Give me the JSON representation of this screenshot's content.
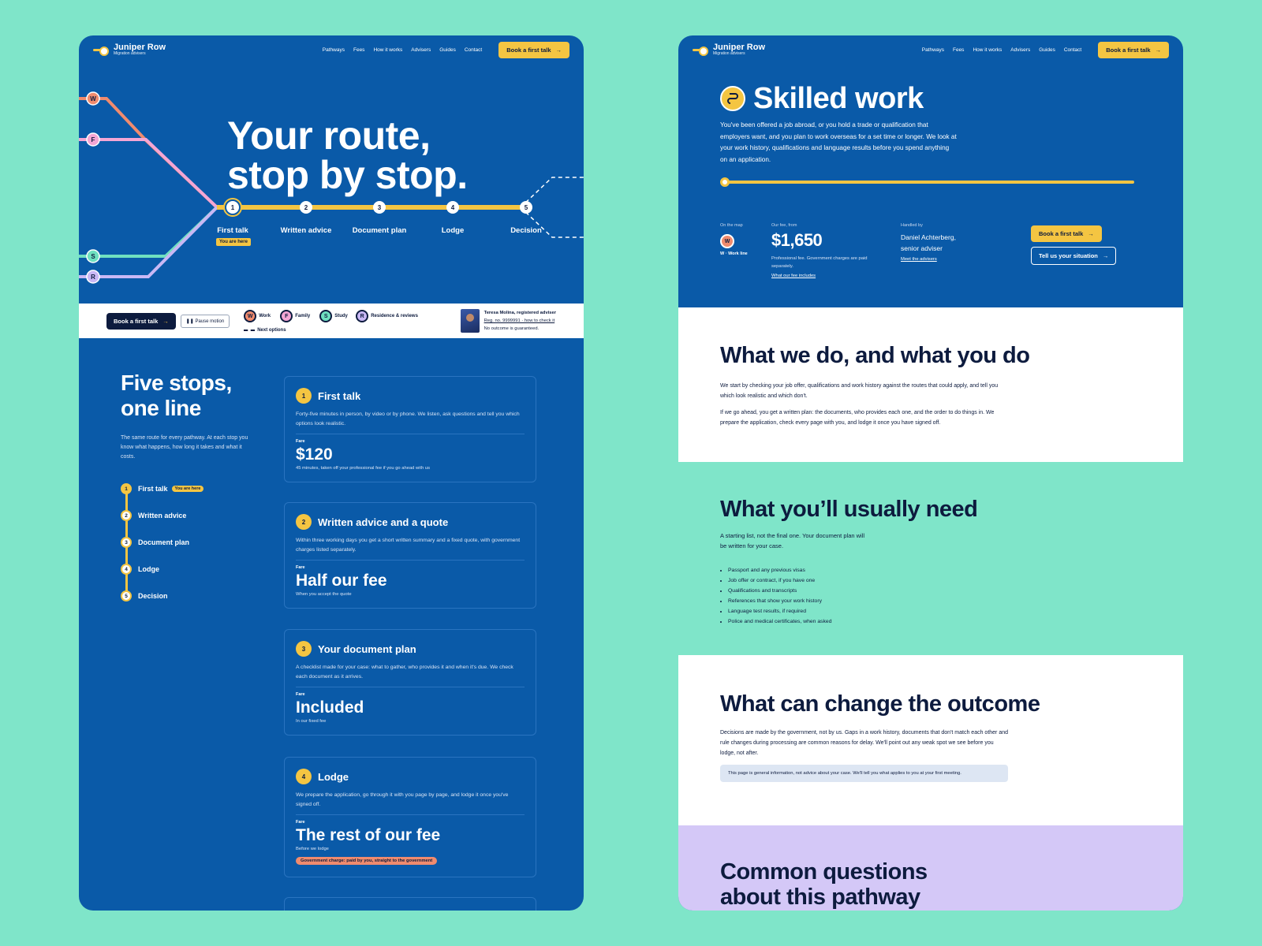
{
  "brand": {
    "name": "Juniper Row",
    "sub": "Migration advisers"
  },
  "nav": {
    "links": [
      "Pathways",
      "Fees",
      "How it works",
      "Advisers",
      "Guides",
      "Contact"
    ],
    "cta": "Book a first talk",
    "arrow": "→"
  },
  "home": {
    "hero_title_1": "Your route,",
    "hero_title_2": "stop by stop.",
    "line_badges": [
      "W",
      "F",
      "S",
      "R"
    ],
    "stations": [
      "First talk",
      "Written advice",
      "Document plan",
      "Lodge",
      "Decision"
    ],
    "station_numbers": [
      "1",
      "2",
      "3",
      "4",
      "5"
    ],
    "you_are_here": "You are here",
    "cta": "Book a first talk",
    "pause": "Pause motion",
    "pause_icon": "❚❚",
    "legend": [
      {
        "badge": "W",
        "label": "Work",
        "color": "#f08b6e"
      },
      {
        "badge": "F",
        "label": "Family",
        "color": "#f4a6d4"
      },
      {
        "badge": "S",
        "label": "Study",
        "color": "#6fe0c0"
      },
      {
        "badge": "R",
        "label": "Residence & reviews",
        "color": "#c9b8f5"
      }
    ],
    "next_options": "Next options",
    "adviser": {
      "name": "Teresa Molina, registered adviser",
      "reg": "Reg. no. 9999991 · how to check it",
      "disclaimer": "No outcome is guaranteed."
    },
    "stops_title_1": "Five stops,",
    "stops_title_2": "one line",
    "stops_desc": "The same route for every pathway. At each stop you know what happens, how long it takes and what it costs.",
    "mini_route": [
      "First talk",
      "Written advice",
      "Document plan",
      "Lodge",
      "Decision"
    ],
    "fare_label": "Fare",
    "cards": [
      {
        "num": "1",
        "title": "First talk",
        "desc": "Forty-five minutes in person, by video or by phone. We listen, ask questions and tell you which options look realistic.",
        "fare": "$120",
        "note": "45 minutes, taken off your professional fee if you go ahead with us"
      },
      {
        "num": "2",
        "title": "Written advice and a quote",
        "desc": "Within three working days you get a short written summary and a fixed quote, with government charges listed separately.",
        "fare": "Half our fee",
        "note": "When you accept the quote"
      },
      {
        "num": "3",
        "title": "Your document plan",
        "desc": "A checklist made for your case: what to gather, who provides it and when it's due. We check each document as it arrives.",
        "fare": "Included",
        "note": "In our fixed fee"
      },
      {
        "num": "4",
        "title": "Lodge",
        "desc": "We prepare the application, go through it with you page by page, and lodge it once you've signed off.",
        "fare": "The rest of our fee",
        "note": "Before we lodge",
        "pill": "Government charge: paid by you, straight to the government"
      }
    ]
  },
  "pathway": {
    "icon": "route-icon",
    "title": "Skilled work",
    "desc": "You've been offered a job abroad, or you hold a trade or qualification that employers want, and you plan to work overseas for a set time or longer. We look at your work history, qualifications and language results before you spend anything on an application.",
    "progress": 0,
    "on_map_label": "On the map",
    "line_badge": "W",
    "line_name": "W · Work line",
    "fee_label": "Our fee, from",
    "fee": "$1,650",
    "fee_note": "Professional fee. Government charges are paid separately.",
    "fee_link": "What our fee includes",
    "handled_label": "Handled by",
    "handled_by_1": "Daniel Achterberg,",
    "handled_by_2": "senior adviser",
    "advisers_link": "Meet the advisers",
    "cta_primary": "Book a first talk",
    "cta_secondary": "Tell us your situation",
    "s1_title": "What we do, and what you do",
    "s1_p1": "We start by checking your job offer, qualifications and work history against the routes that could apply, and tell you which look realistic and which don't.",
    "s1_p2": "If we go ahead, you get a written plan: the documents, who provides each one, and the order to do things in. We prepare the application, check every page with you, and lodge it once you have signed off.",
    "s2_title": "What you’ll usually need",
    "s2_desc": "A starting list, not the final one. Your document plan will be written for your case.",
    "s2_items": [
      "Passport and any previous visas",
      "Job offer or contract, if you have one",
      "Qualifications and transcripts",
      "References that show your work history",
      "Language test results, if required",
      "Police and medical certificates, when asked"
    ],
    "s3_title": "What can change the outcome",
    "s3_p": "Decisions are made by the government, not by us. Gaps in a work history, documents that don't match each other and rule changes during processing are common reasons for delay. We'll point out any weak spot we see before you lodge, not after.",
    "s3_note": "This page is general information, not advice about your case. We'll tell you what applies to you at your first meeting.",
    "s4_title_1": "Common questions",
    "s4_title_2": "about this pathway"
  },
  "colors": {
    "navy": "#0d1b3e",
    "blue": "#0a5aa8",
    "yellow": "#f4c542",
    "mint": "#7fe5c9",
    "lavender": "#d4c8f7"
  }
}
